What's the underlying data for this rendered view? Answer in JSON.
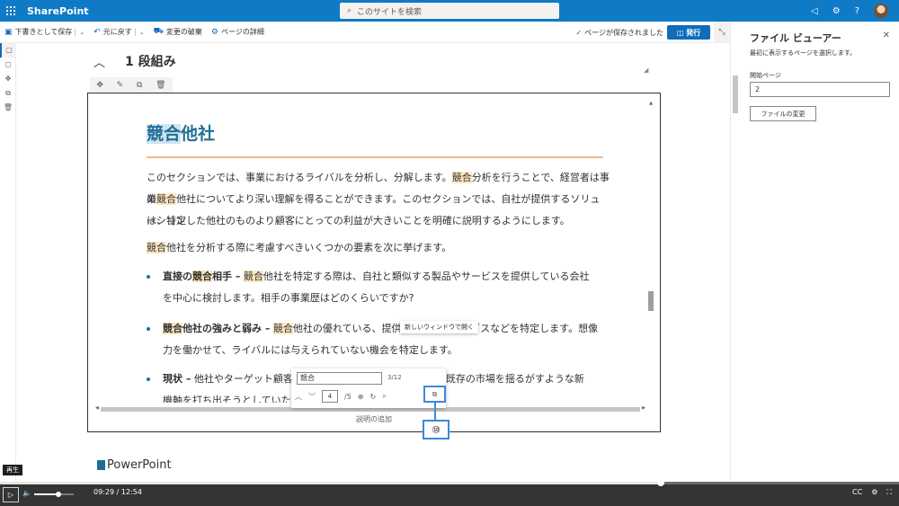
{
  "suitebar": {
    "brand": "SharePoint",
    "search_placeholder": "このサイトを検索",
    "icons": [
      "waffle-icon",
      "megaphone-icon",
      "gear-icon",
      "help-icon",
      "avatar"
    ]
  },
  "cmdbar": {
    "save_draft": "下書きとして保存",
    "undo": "元に戻す",
    "discard": "変更の破棄",
    "page_details": "ページの詳細",
    "saved_status": "ページが保存されました",
    "publish": "発行"
  },
  "canvas": {
    "section_title": "1 段組み",
    "caption": "説明の追加",
    "ppt_label": "PowerPoint"
  },
  "doc": {
    "title_hl": "競合",
    "title_rest": "他社",
    "p1_a": "このセクションでは、事業におけるライバルを分析し、分解します。",
    "p1_hl": "競合",
    "p1_b": "分析を行うことで、経営者は事業",
    "p2_a": "の",
    "p2_hl": "競合",
    "p2_b": "他社についてより深い理解を得ることができます。このセクションでは、自社が提供するソリューション",
    "p3": "は、特定した他社のものより顧客にとっての利益が大きいことを明確に説明するようにします。",
    "p4_hl": "競合",
    "p4_b": "他社を分析する際に考慮すべきいくつかの要素を次に挙げます。",
    "b1_bold_a": "直接の",
    "b1_bold_hl": "競合",
    "b1_bold_b": "相手 –",
    "b1_hl": "競合",
    "b1_text": "他社を特定する際は、自社と類似する製品やサービスを提供している会社",
    "b1_line2": "を中心に検討します。相手の事業歴はどのくらいですか?",
    "b2_bold_hl": "競合",
    "b2_bold_b": "他社の強みと弱み –",
    "b2_hl": "競合",
    "b2_text": "他社の優れている、提供していないサービスなどを特定します。想像",
    "b2_line2": "力を働かせて、ライバルには与えられていない機会を特定します。",
    "b3_bold": "現状 –",
    "b3_text": "他社やターゲット顧客",
    "b3_text_tail": "既存の市場を揺るがすような新",
    "b3_line2": "機軸を打ち出そうとしていたり"
  },
  "findbar": {
    "query": "競合",
    "count": "3/12",
    "page": "4",
    "total_pages": "/5",
    "tooltip": "新しいウィンドウで開く",
    "callout": "⑩"
  },
  "panel": {
    "title": "ファイル ビューアー",
    "description": "最初に表示するページを選択します。",
    "start_page_label": "開始ページ",
    "start_page_value": "2",
    "change_file": "ファイルの変更"
  },
  "player": {
    "play_tooltip": "再生",
    "current_time": "09:29",
    "separator": "/",
    "duration": "12:54",
    "progress": 0.735
  }
}
